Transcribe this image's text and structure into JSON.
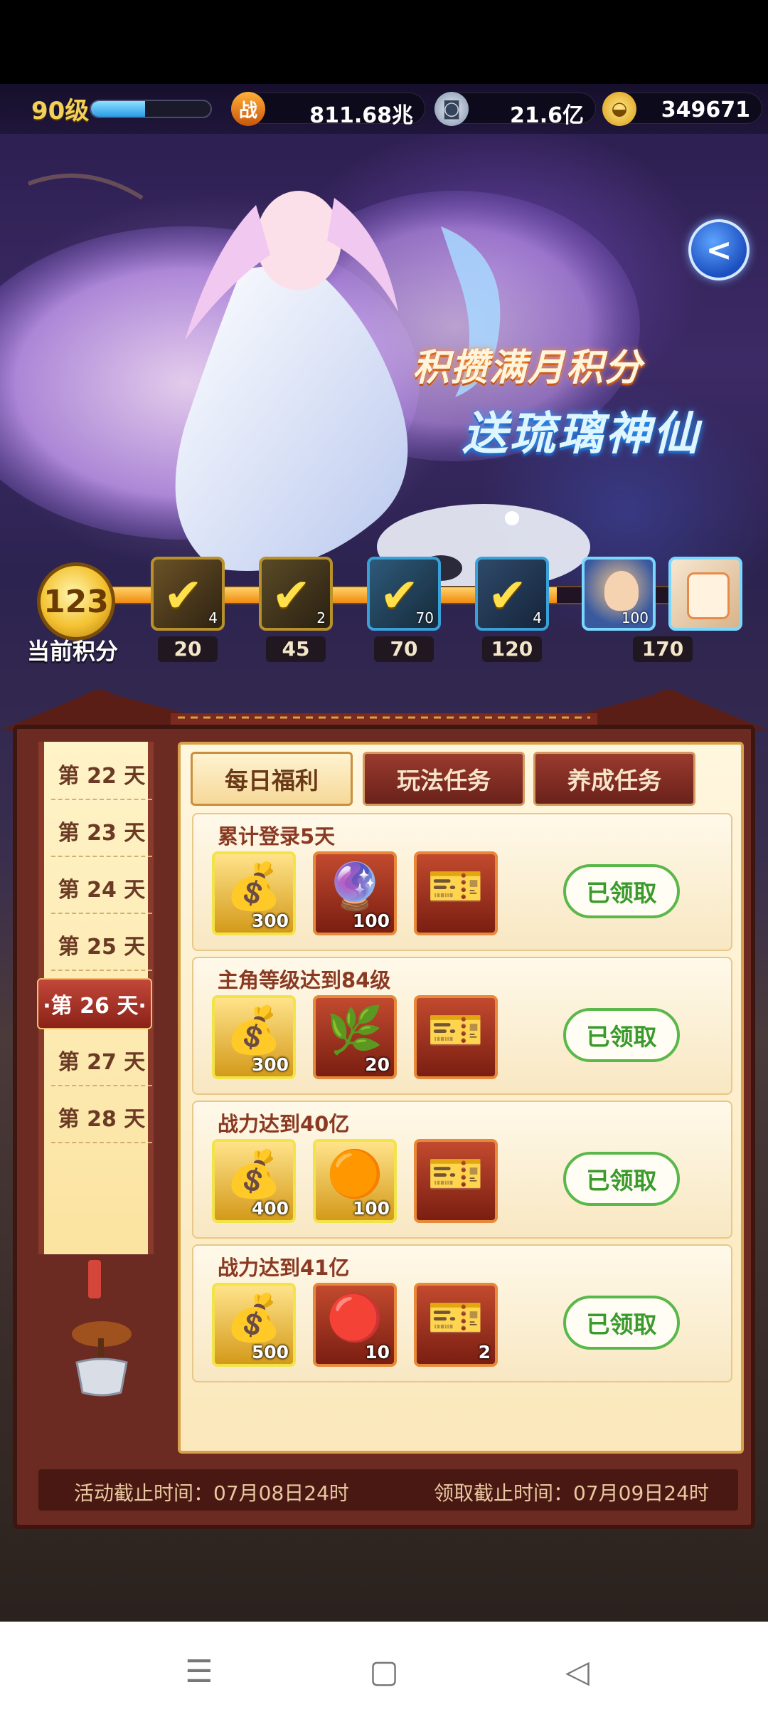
{
  "player": {
    "level": "90级",
    "exp_fraction": 0.45,
    "power": "811.68兆",
    "silver": "21.6亿",
    "gold": "349671"
  },
  "banner": {
    "slogan_line1": "积攒满月积分",
    "slogan_line2": "送琉璃神仙"
  },
  "score": {
    "current": "123",
    "label": "当前积分",
    "progress_fraction": 0.72,
    "milestones": [
      {
        "value": "20",
        "qty": "4",
        "claimed": true
      },
      {
        "value": "45",
        "qty": "2",
        "claimed": true
      },
      {
        "value": "70",
        "qty": "70",
        "claimed": true
      },
      {
        "value": "120",
        "qty": "4",
        "claimed": true
      },
      {
        "value": "",
        "qty": "100",
        "claimed": false
      },
      {
        "value": "170",
        "qty": "",
        "claimed": false
      }
    ]
  },
  "days": [
    {
      "label": "第 22 天"
    },
    {
      "label": "第 23 天"
    },
    {
      "label": "第 24 天"
    },
    {
      "label": "第 25 天"
    },
    {
      "label": "·第 26 天·"
    },
    {
      "label": "第 27 天"
    },
    {
      "label": "第 28 天"
    }
  ],
  "tabs": [
    {
      "label": "每日福利"
    },
    {
      "label": "玩法任务"
    },
    {
      "label": "养成任务"
    }
  ],
  "tasks": [
    {
      "title": "累计登录5天",
      "rewards": [
        "300",
        "100",
        ""
      ],
      "status": "已领取"
    },
    {
      "title": "主角等级达到84级",
      "rewards": [
        "300",
        "20",
        ""
      ],
      "status": "已领取"
    },
    {
      "title": "战力达到40亿",
      "rewards": [
        "400",
        "100",
        ""
      ],
      "status": "已领取"
    },
    {
      "title": "战力达到41亿",
      "rewards": [
        "500",
        "10",
        "2"
      ],
      "status": "已领取"
    }
  ],
  "footer": {
    "activity_end": "活动截止时间：07月08日24时",
    "claim_end": "领取截止时间：07月09日24时"
  },
  "icons": {
    "power": "战",
    "back": "<"
  }
}
